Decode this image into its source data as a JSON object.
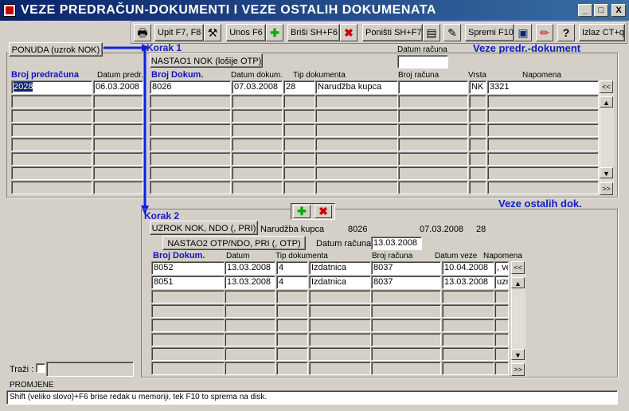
{
  "window": {
    "title": "VEZE PREDRAČUN-DOKUMENTI I VEZE OSTALIH DOKUMENATA",
    "min": "_",
    "max": "□",
    "close": "X"
  },
  "toolbar": {
    "upit": "Upit F7, F8",
    "unos": "Unos F6",
    "brisi": "Briši  SH+F6",
    "ponisti": "Poništi SH+F7",
    "spremi": "Spremi F10",
    "help": "?",
    "izlaz": "Izlaz CT+q"
  },
  "top": {
    "ponuda_btn": "PONUDA  (uzrok NOK)",
    "korak1": "Korak 1",
    "nastao1_btn": "NASTAO1 NOK (lošije OTP)",
    "datum_racuna_label": "Datum računa",
    "datum_racuna": "",
    "section_title": "Veze predr.-dokument",
    "headers": {
      "broj_pred": "Broj predračuna",
      "datum_pred": "Datum predr.",
      "broj_dok": "Broj Dokum.",
      "datum_dok": "Datum dokum.",
      "tip": "Tip dokumenta",
      "broj_rac": "Broj računa",
      "vrsta": "Vrsta",
      "napomena": "Napomena"
    },
    "rows": [
      {
        "broj_pred": "2028",
        "datum_pred": "06.03.2008",
        "broj_dok": "8026",
        "datum_dok": "07.03.2008",
        "tip_kod": "28",
        "tip": "Narudžba kupca",
        "broj_rac": "",
        "vrsta": "NK",
        "napomena": "3321"
      }
    ]
  },
  "bottom": {
    "korak2": "Korak 2",
    "section_title": "Veze ostalih dok.",
    "uzrok_btn": "UZROK NOK, NDO (, PRI)",
    "info_tip": "Narudžba kupca",
    "info_broj": "8026",
    "info_datum": "07.03.2008",
    "info_kod": "28",
    "nastao2_btn": "NASTAO2 OTP/NDO, PRI (, OTP)",
    "datum_racuna_label": "Datum računa",
    "datum_racuna": "13.03.2008",
    "headers": {
      "broj_dok": "Broj Dokum.",
      "datum": "Datum",
      "tip": "Tip dokumenta",
      "broj_rac": "Broj računa",
      "datum_veze": "Datum veze",
      "napomena": "Napomena"
    },
    "rows": [
      {
        "broj_dok": "8052",
        "datum": "13.03.2008",
        "tip_kod": "4",
        "tip": "Izdatnica",
        "broj_rac": "8037",
        "datum_veze": "10.04.2008",
        "napomena": ", ve"
      },
      {
        "broj_dok": "8051",
        "datum": "13.03.2008",
        "tip_kod": "4",
        "tip": "Izdatnica",
        "broj_rac": "8037",
        "datum_veze": "13.03.2008",
        "napomena": "uzr"
      }
    ]
  },
  "search": {
    "label": "Traži :",
    "value": ""
  },
  "status": {
    "title": "PROMJENE",
    "message": "Shift (veliko slovo)+F6 brise redak u memoriji, tek F10 to sprema na disk."
  },
  "colors": {
    "title_bar": "#0a246a",
    "accent_blue": "#1020c0"
  }
}
